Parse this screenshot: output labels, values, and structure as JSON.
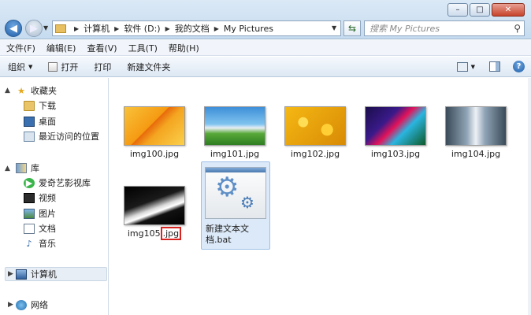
{
  "window": {
    "min_glyph": "–",
    "max_glyph": "□",
    "close_glyph": "✕"
  },
  "address": {
    "crumbs": [
      "计算机",
      "软件 (D:)",
      "我的文档",
      "My Pictures"
    ],
    "search_placeholder": "搜索 My Pictures"
  },
  "menu": [
    "文件(F)",
    "编辑(E)",
    "查看(V)",
    "工具(T)",
    "帮助(H)"
  ],
  "commands": {
    "organize": "组织",
    "open": "打开",
    "print": "打印",
    "new_folder": "新建文件夹"
  },
  "nav": {
    "favorites": "收藏夹",
    "downloads": "下载",
    "desktop": "桌面",
    "recent": "最近访问的位置",
    "libraries": "库",
    "iqiyi": "爱奇艺影视库",
    "videos": "视频",
    "pictures": "图片",
    "documents": "文档",
    "music": "音乐",
    "computer": "计算机",
    "network": "网络"
  },
  "files": [
    {
      "name": "img100.jpg"
    },
    {
      "name": "img101.jpg"
    },
    {
      "name": "img102.jpg"
    },
    {
      "name": "img103.jpg"
    },
    {
      "name": "img104.jpg"
    },
    {
      "name_base": "img105",
      "name_ext": ".jpg"
    },
    {
      "name": "新建文本文档.bat"
    }
  ],
  "colors": {
    "selection_bg": "#dce9f8",
    "highlight_box": "#d9231f"
  }
}
